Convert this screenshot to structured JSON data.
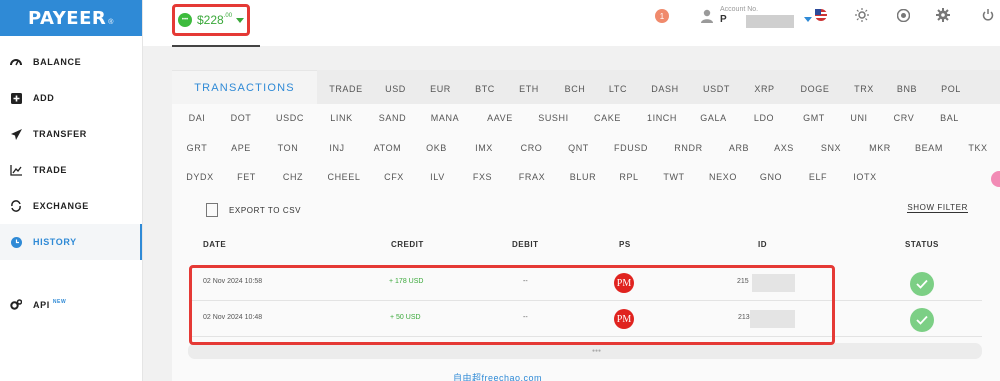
{
  "brand": {
    "name": "PAYEER",
    "mark": "®"
  },
  "sidebar": {
    "items": [
      {
        "label": "BALANCE",
        "icon": "gauge-icon"
      },
      {
        "label": "ADD",
        "icon": "plus-square-icon"
      },
      {
        "label": "TRANSFER",
        "icon": "paper-plane-icon"
      },
      {
        "label": "TRADE",
        "icon": "line-chart-icon"
      },
      {
        "label": "EXCHANGE",
        "icon": "exchange-icon"
      },
      {
        "label": "HISTORY",
        "icon": "clock-icon"
      },
      {
        "label": "API",
        "icon": "gears-icon",
        "badge": "NEW"
      }
    ],
    "active": "HISTORY"
  },
  "topbar": {
    "balance": {
      "amount": "$228",
      "decimals": ".00"
    },
    "notifications": "1",
    "account": {
      "label": "Account No.",
      "value": "P"
    },
    "colors": {
      "accent": "#2f8ad6",
      "green": "#3aa83a",
      "highlight": "#e53935"
    }
  },
  "transactions": {
    "tab": "TRANSACTIONS",
    "rows": [
      [
        "TRADE",
        "USD",
        "EUR",
        "BTC",
        "ETH",
        "BCH",
        "LTC",
        "DASH",
        "USDT",
        "XRP",
        "DOGE",
        "TRX",
        "BNB",
        "POL"
      ],
      [
        "DAI",
        "DOT",
        "USDC",
        "LINK",
        "SAND",
        "MANA",
        "AAVE",
        "SUSHI",
        "CAKE",
        "1INCH",
        "GALA",
        "LDO",
        "GMT",
        "UNI",
        "CRV",
        "BAL"
      ],
      [
        "GRT",
        "APE",
        "TON",
        "INJ",
        "ATOM",
        "OKB",
        "IMX",
        "CRO",
        "QNT",
        "FDUSD",
        "RNDR",
        "ARB",
        "AXS",
        "SNX",
        "MKR",
        "BEAM",
        "TKX"
      ],
      [
        "DYDX",
        "FET",
        "CHZ",
        "CHEEL",
        "CFX",
        "ILV",
        "FXS",
        "FRAX",
        "BLUR",
        "RPL",
        "TWT",
        "NEXO",
        "GNO",
        "ELF",
        "IOTX"
      ]
    ],
    "export": "EXPORT TO CSV",
    "filter": "SHOW FILTER",
    "headers": {
      "date": "DATE",
      "credit": "CREDIT",
      "debit": "DEBIT",
      "ps": "PS",
      "id": "ID",
      "status": "STATUS"
    },
    "list": [
      {
        "date": "02 Nov 2024 10:58",
        "credit": "+ 178 USD",
        "debit": "--",
        "ps": "PM",
        "id": "215"
      },
      {
        "date": "02 Nov 2024 10:48",
        "credit": "+ 50 USD",
        "debit": "--",
        "ps": "PM",
        "id": "213"
      }
    ]
  },
  "watermark": "自由超freechao.com"
}
